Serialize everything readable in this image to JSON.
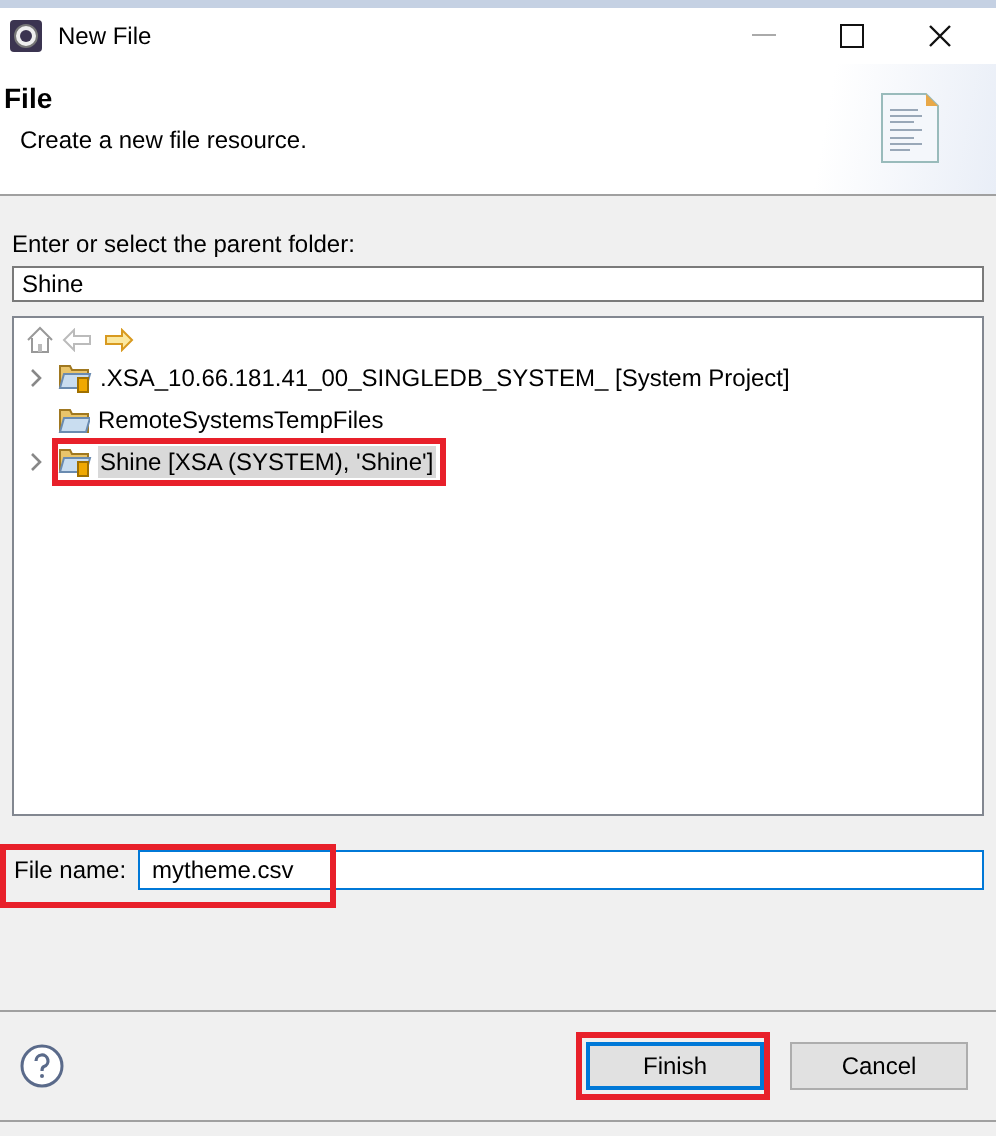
{
  "window": {
    "title": "New File"
  },
  "header": {
    "title": "File",
    "description": "Create a new file resource."
  },
  "folder": {
    "label": "Enter or select the parent folder:",
    "value": "Shine"
  },
  "tree": {
    "items": [
      {
        "label": ".XSA_10.66.181.41_00_SINGLEDB_SYSTEM_ [System Project]",
        "kind": "project",
        "expandable": true,
        "selected": false,
        "highlighted": false
      },
      {
        "label": "RemoteSystemsTempFiles",
        "kind": "folder",
        "expandable": false,
        "selected": false,
        "highlighted": false
      },
      {
        "label": "Shine [XSA (SYSTEM), 'Shine']",
        "kind": "project",
        "expandable": true,
        "selected": true,
        "highlighted": true
      }
    ]
  },
  "file_name": {
    "label": "File name:",
    "value": "mytheme.csv",
    "highlighted": true
  },
  "buttons": [
    {
      "label": "Finish",
      "default": true,
      "highlighted": true
    },
    {
      "label": "Cancel",
      "default": false,
      "highlighted": false
    }
  ]
}
